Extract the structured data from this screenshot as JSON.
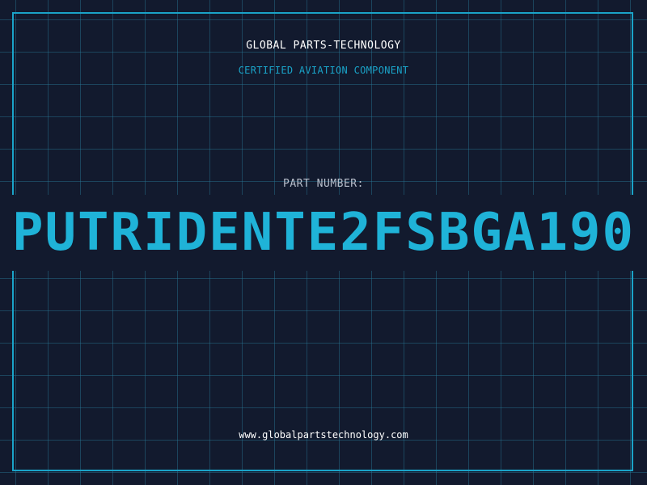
{
  "header": {
    "company": "GLOBAL PARTS-TECHNOLOGY",
    "subtitle": "CERTIFIED AVIATION COMPONENT"
  },
  "part": {
    "label": "PART NUMBER:",
    "number": "PUTRIDENTE2FSBGA190"
  },
  "footer": {
    "url": "www.globalpartstechnology.com"
  },
  "colors": {
    "background": "#121a2e",
    "grid": "#287896",
    "accent": "#1aa3c8",
    "part_number": "#1fb3d8",
    "text_light": "#ffffff",
    "text_muted": "#b8bfcc"
  }
}
